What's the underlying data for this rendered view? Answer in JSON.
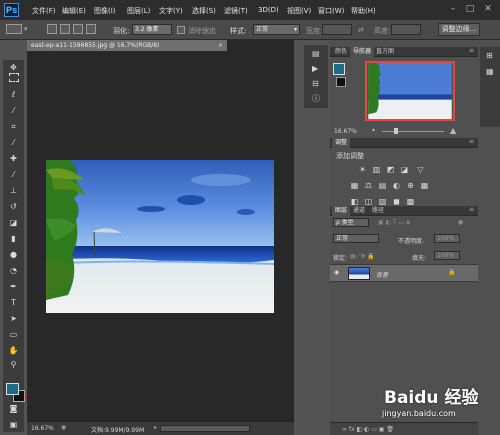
{
  "menubar": {
    "logo": "Ps",
    "items": [
      "文件(F)",
      "编辑(E)",
      "图像(I)",
      "图层(L)",
      "文字(Y)",
      "选择(S)",
      "滤镜(T)",
      "3D(D)",
      "视图(V)",
      "窗口(W)",
      "帮助(H)"
    ],
    "win_minimize": "–",
    "win_restore": "□",
    "win_close": "✕"
  },
  "options": {
    "feather_label": "羽化:",
    "feather_value": "3.2 像素",
    "antialias_label": "消除锯齿",
    "style_label": "样式:",
    "style_value": "正常",
    "width_label": "宽度:",
    "height_label": "高度:",
    "refine_button": "调整边缘..."
  },
  "document": {
    "tab_title": "east-ep-a11-1596855.jpg @ 16.7%(RGB/8)",
    "tab_close": "×",
    "zoom": "16.67%",
    "doc_info": "文档:9.99M/9.99M"
  },
  "navigator": {
    "tabs": [
      "颜色",
      "导航器",
      "直方图"
    ],
    "active_tab": "导航器",
    "zoom": "16.67%"
  },
  "adjustments": {
    "tab": "调整",
    "title": "添加调整",
    "row1": [
      "☀",
      "▥",
      "◩",
      "◪",
      "▽"
    ],
    "row2": [
      "▦",
      "⚖",
      "▤",
      "◐",
      "⊕",
      "▦"
    ],
    "row3": [
      "◧",
      "◫",
      "▨",
      "◼",
      "▩"
    ]
  },
  "layers": {
    "tabs": [
      "图层",
      "通道",
      "路径"
    ],
    "active_tab": "图层",
    "filter_label": "ρ 类型",
    "blend_mode": "正常",
    "opacity_label": "不透明度:",
    "opacity_value": "100%",
    "lock_label": "锁定:",
    "fill_label": "填充:",
    "fill_value": "100%",
    "items": [
      {
        "name": "背景",
        "visible": true,
        "locked": true
      }
    ]
  },
  "toolbox": {
    "tools": [
      "move-tool",
      "marquee-tool",
      "lasso-tool",
      "quick-select-tool",
      "crop-tool",
      "eyedropper-tool",
      "healing-brush-tool",
      "brush-tool",
      "clone-stamp-tool",
      "history-brush-tool",
      "eraser-tool",
      "gradient-tool",
      "blur-tool",
      "dodge-tool",
      "pen-tool",
      "type-tool",
      "path-select-tool",
      "shape-tool",
      "hand-tool",
      "zoom-tool"
    ],
    "foreground_color": "#1b6e86",
    "background_color": "#111111"
  },
  "watermark": {
    "brand": "Baidu 经验",
    "url": "jingyan.baidu.com"
  },
  "colors": {
    "annotation_arrow": "#e02020"
  }
}
